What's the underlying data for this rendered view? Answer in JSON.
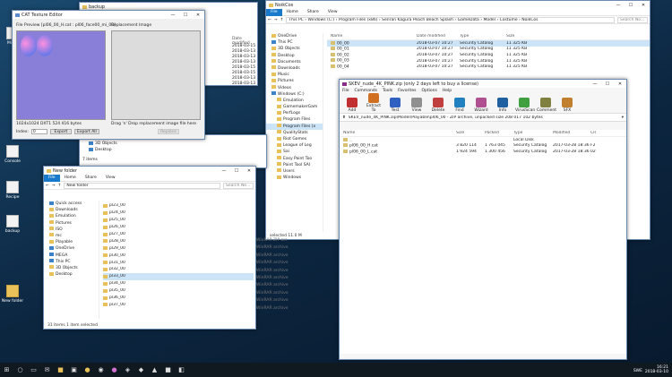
{
  "desktop": {
    "icons": [
      "Micro",
      "Console",
      "Recipe",
      "backup",
      "New folder"
    ]
  },
  "cat": {
    "title": "CAT Texture Editor",
    "preview_label": "File Preview [pl06_00_H.cat : pl06_face00_mi_00]",
    "replacement_label": "Replacement Image",
    "info": "1024x1024 DXT1 524 416 bytes",
    "drag": "Drag 'n' Drop replacement image file here",
    "index_label": "Index:",
    "index_value": "0",
    "export_btn": "Export",
    "export_all_btn": "Export All",
    "replace_btn": "Replace"
  },
  "explorer_main": {
    "title": "NoikCos",
    "ribbon": [
      "File",
      "Home",
      "Share",
      "View"
    ],
    "path": "This PC › Windows (C:) › Program Files (x86) › Senran Kagura Peach Beach Splash › GameData › Model › Costume › NoikCos",
    "search": "Search No...",
    "nav": [
      "OneDrive",
      "This PC",
      "3D Objects",
      "Desktop",
      "Documents",
      "Downloads",
      "Music",
      "Pictures",
      "Videos",
      "Windows (C:)",
      "Emulation",
      "GamemakerGam",
      "PerfLogs",
      "Program Files",
      "Program Files (x",
      "QualityStats",
      "Riot Games",
      "League of Leg",
      "Sai",
      "Easy Paint Too",
      "Paint Tool SAI",
      "Users",
      "Windows"
    ],
    "columns": [
      "Name",
      "Date modified",
      "Type",
      "Size"
    ],
    "files": [
      {
        "name": "00_00",
        "date": "2018-03-07 10:27",
        "type": "Security Catalog",
        "size": "11 325 KB"
      },
      {
        "name": "00_01",
        "date": "2018-03-07 10:27",
        "type": "Security Catalog",
        "size": "11 325 KB"
      },
      {
        "name": "00_02",
        "date": "2018-03-07 10:27",
        "type": "Security Catalog",
        "size": "11 325 KB"
      },
      {
        "name": "00_03",
        "date": "2018-03-07 10:27",
        "type": "Security Catalog",
        "size": "11 325 KB"
      },
      {
        "name": "00_04",
        "date": "2018-03-07 10:27",
        "type": "Security Catalog",
        "size": "11 325 KB"
      }
    ],
    "status": "selected  11.0 M"
  },
  "backup": {
    "title": "backup",
    "date_header": "Date modified",
    "dates": [
      "2018-03-15 10:5",
      "2018-03-13 10:5",
      "2018-03-13 10:5",
      "2018-03-13 10:5",
      "2018-03-15 10:5",
      "2018-03-15 10:5",
      "2018-03-13 10:5",
      "2018-03-13 10:5",
      "2018-03-13 10:5",
      "2018-03-09 10:1"
    ]
  },
  "explorer_new": {
    "title": "New folder",
    "ribbon": [
      "File",
      "Home",
      "Share",
      "View"
    ],
    "path": "New folder",
    "search": "Search Ne...",
    "nav": [
      "Quick access",
      "Downloads",
      "Emulation",
      "Pictures",
      "ISO",
      "mc",
      "Playable",
      "OneDrive",
      "MEGA",
      "This PC",
      "3D Objects",
      "Desktop"
    ],
    "folders": [
      "pl23_00",
      "pl24_00",
      "pl25_00",
      "pl26_00",
      "pl27_00",
      "pl28_00",
      "pl29_00",
      "pl30_00",
      "pl31_00",
      "pl32_00",
      "pl33_00",
      "pl34_00",
      "pl35_00",
      "pl36_00",
      "pl37_00"
    ],
    "status": "31 items   1 item selected",
    "partial": [
      "WinRAR ZIP arc",
      "WinRAR archive",
      "WinRAR archive",
      "WinRAR archive",
      "WinRAR archive",
      "WinRAR archive",
      "WinRAR archive",
      "WinRAR archive",
      "WinRAR archive",
      "WinRAR archive"
    ]
  },
  "explorer_left": {
    "items": [
      "3D Objects",
      "Desktop"
    ],
    "status": "7 items"
  },
  "winrar": {
    "title": "SKEV_nude_4K_PINK.zip (only 2 days left to buy a license)",
    "menu": [
      "File",
      "Commands",
      "Tools",
      "Favorites",
      "Options",
      "Help"
    ],
    "tools": [
      "Add",
      "Extract To",
      "Test",
      "View",
      "Delete",
      "Find",
      "Wizard",
      "Info",
      "VirusScan",
      "Comment",
      "SFX"
    ],
    "path": "SKEV_nude_4K_PINK.zip\\Model\\Playable\\pl06_00 - ZIP archive, unpacked size 208 017 102 bytes",
    "columns": [
      "Name",
      "Size",
      "Packed",
      "Type",
      "Modified",
      "CR"
    ],
    "rows": [
      {
        "name": "..",
        "size": "",
        "packed": "",
        "type": "Local Disk",
        "modified": "",
        "crc": ""
      },
      {
        "name": "pl06_00_H.cat",
        "size": "3 820 114",
        "packed": "1 763 045",
        "type": "Security Catalog",
        "modified": "2017-03-28 18:36",
        "crc": "F2"
      },
      {
        "name": "pl06_00_L.cat",
        "size": "1 924 594",
        "packed": "1 300 456",
        "type": "Security Catalog",
        "modified": "2017-03-28 18:36",
        "crc": "02"
      }
    ]
  },
  "taskbar": {
    "time": "16:21",
    "date": "2018-03-10",
    "lang": "SWE"
  }
}
